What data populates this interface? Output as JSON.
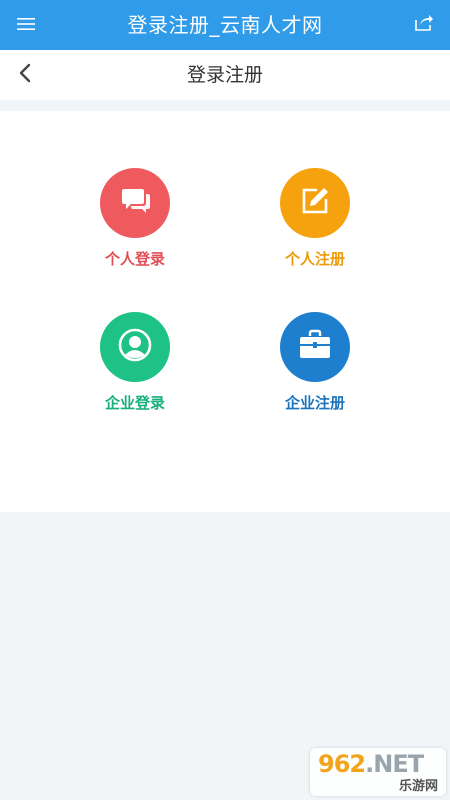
{
  "appbar": {
    "title": "登录注册_云南人才网"
  },
  "subheader": {
    "title": "登录注册"
  },
  "tiles": [
    {
      "label": "个人登录",
      "color": "#ef5a5f",
      "icon": "chat-bubbles-icon"
    },
    {
      "label": "个人注册",
      "color": "#f6a20e",
      "icon": "edit-icon"
    },
    {
      "label": "企业登录",
      "color": "#1ec186",
      "icon": "user-circle-icon"
    },
    {
      "label": "企业注册",
      "color": "#1d7fce",
      "icon": "briefcase-icon"
    }
  ],
  "colors": {
    "appbar": "#2f9be9",
    "background": "#f2f5f8"
  },
  "watermark": {
    "top": "962.NET",
    "bottom": "乐游网"
  }
}
